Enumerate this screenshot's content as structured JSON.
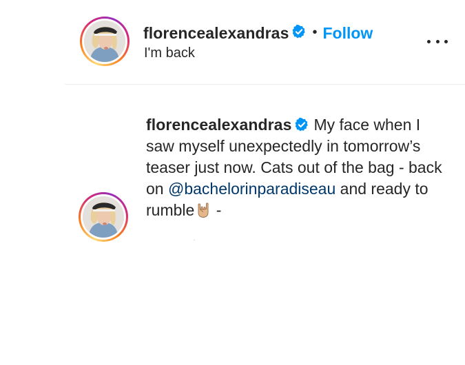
{
  "header": {
    "username": "florencealexandras",
    "separator": "•",
    "follow_label": "Follow",
    "subtitle": "I'm back"
  },
  "comment": {
    "username": "florencealexandras",
    "text_before_mention": "My face when I saw myself unexpectedly in tomorrow’s teaser just now. Cats out of the bag - back on ",
    "mention": "@bachelorinparadiseau",
    "text_after_mention": " and ready to rumble",
    "text_trailing": " -"
  },
  "icons": {
    "avatar": "profile-avatar",
    "verified": "verified-badge-icon",
    "more": "more-options-icon",
    "emoji": "sign-of-the-horns-emoji"
  },
  "colors": {
    "follow": "#0095f6",
    "verified": "#0095f6",
    "mention": "#00376b",
    "text": "#262626",
    "divider": "#efefef"
  }
}
